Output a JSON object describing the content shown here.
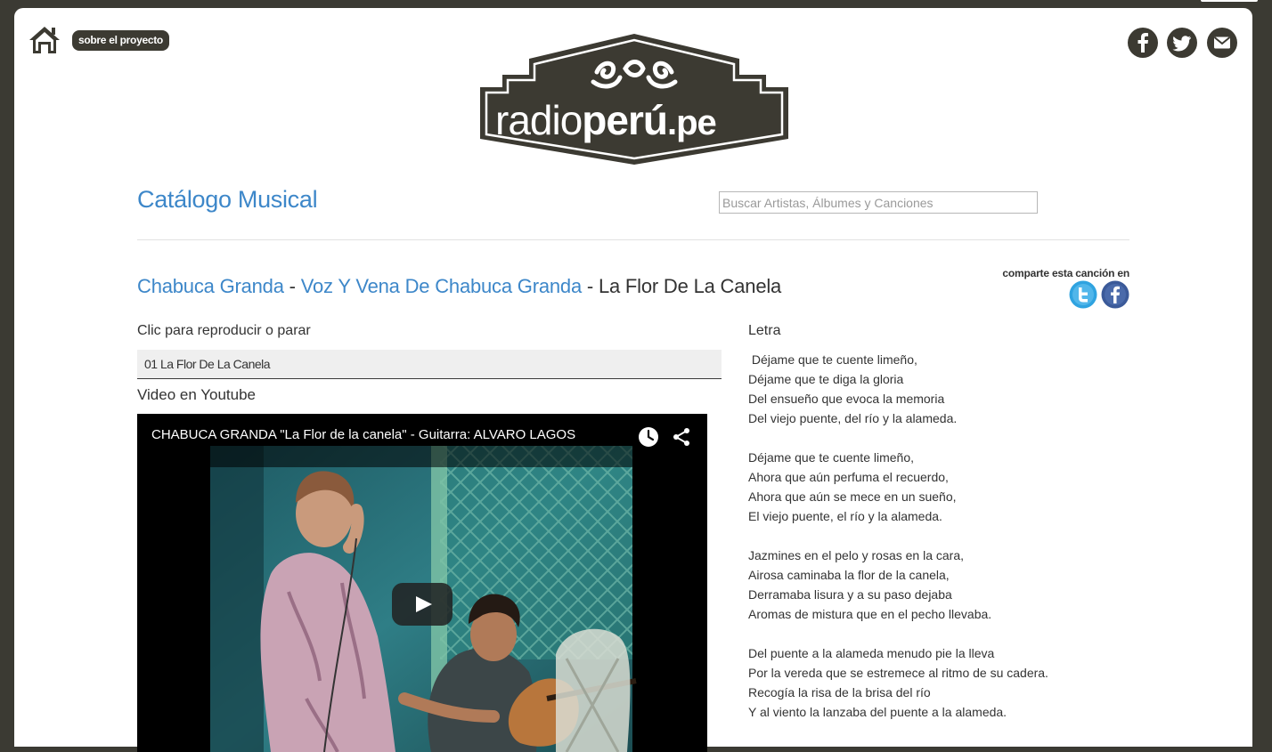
{
  "header": {
    "about_label": "sobre el proyecto",
    "logo_text": "radioperú.pe"
  },
  "catalog": {
    "title": "Catálogo Musical",
    "search_placeholder": "Buscar Artistas, Álbumes y Canciones"
  },
  "song": {
    "artist": "Chabuca Granda",
    "album": "Voz Y Vena De Chabuca Granda",
    "title": "La Flor De La Canela",
    "separator": " - "
  },
  "share": {
    "label": "comparte esta canción en"
  },
  "player": {
    "instruction": "Clic para reproducir o parar",
    "track": "01 La Flor De La Canela"
  },
  "video": {
    "label": "Video en Youtube",
    "title": "CHABUCA GRANDA \"La Flor de la canela\" - Guitarra: ALVARO LAGOS"
  },
  "lyrics": {
    "title": "Letra",
    "stanzas": [
      [
        " Déjame que te cuente limeño,",
        "Déjame que te diga la gloria",
        "Del ensueño que evoca la memoria",
        "Del viejo puente, del río y la alameda."
      ],
      [
        "Déjame que te cuente limeño,",
        "Ahora que aún perfuma el recuerdo,",
        "Ahora que aún se mece en un sueño,",
        "El viejo puente, el río y la alameda."
      ],
      [
        "Jazmines en el pelo y rosas en la cara,",
        "Airosa caminaba la flor de la canela,",
        "Derramaba lisura y a su paso dejaba",
        "Aromas de mistura que en el pecho llevaba."
      ],
      [
        "Del puente a la alameda menudo pie la lleva",
        "Por la vereda que se estremece al ritmo de su cadera.",
        "Recogía la risa de la brisa del río",
        "Y al viento la lanzaba del puente a la alameda."
      ]
    ]
  },
  "colors": {
    "link": "#3d87c9",
    "dark": "#3c3a32",
    "twitter": "#2fa3e0",
    "facebook": "#3b5a99"
  },
  "icons": [
    "home-icon",
    "facebook-icon",
    "twitter-icon",
    "mail-icon",
    "clock-icon",
    "share-icon",
    "play-icon"
  ]
}
